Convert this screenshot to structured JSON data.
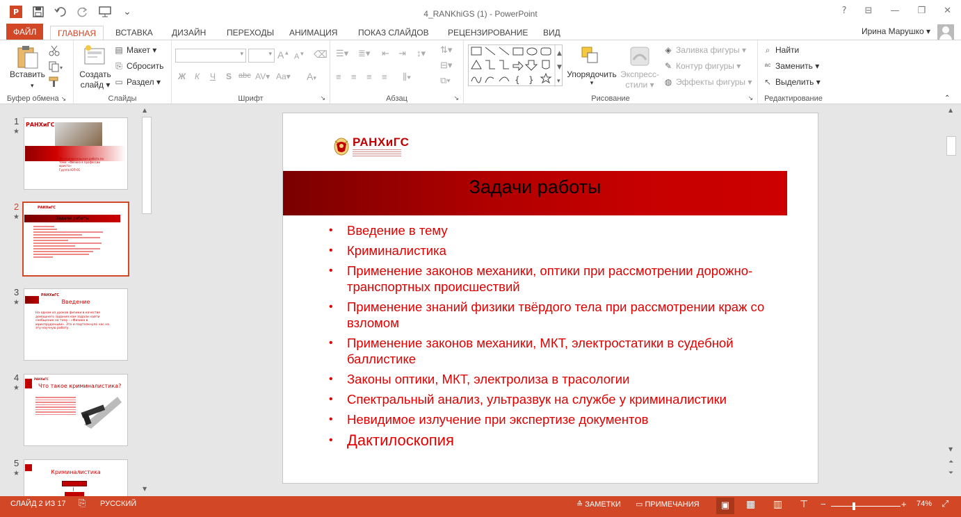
{
  "window": {
    "title": "4_RANKhiGS (1) - PowerPoint",
    "help": "?",
    "restore_ribbon": "⊟",
    "minimize": "—",
    "maximize": "❐",
    "close": "✕"
  },
  "qat": {
    "app_logo": "P",
    "save_icon": "save-icon",
    "undo_icon": "undo-icon",
    "redo_icon": "redo-icon",
    "present_icon": "present-icon",
    "customize": "⌄"
  },
  "tabs": [
    "ФАЙЛ",
    "ГЛАВНАЯ",
    "ВСТАВКА",
    "ДИЗАЙН",
    "ПЕРЕХОДЫ",
    "АНИМАЦИЯ",
    "ПОКАЗ СЛАЙДОВ",
    "РЕЦЕНЗИРОВАНИЕ",
    "ВИД"
  ],
  "user": {
    "name": "Ирина Марушко"
  },
  "ribbon": {
    "clipboard": {
      "label": "Буфер обмена",
      "paste": "Вставить"
    },
    "slides": {
      "label": "Слайды",
      "new_slide_1": "Создать",
      "new_slide_2": "слайд",
      "layout": "Макет",
      "reset": "Сбросить",
      "section": "Раздел"
    },
    "font": {
      "label": "Шрифт",
      "bold": "Ж",
      "italic": "К",
      "underline": "Ч",
      "shadow": "S",
      "strike": "abc",
      "spacing": "AV",
      "case": "Aa",
      "grow": "A",
      "shrink": "A",
      "color": "A"
    },
    "paragraph": {
      "label": "Абзац"
    },
    "drawing": {
      "label": "Рисование",
      "arrange": "Упорядочить",
      "quick_styles_1": "Экспресс-",
      "quick_styles_2": "стили",
      "fill": "Заливка фигуры",
      "outline": "Контур фигуры",
      "effects": "Эффекты фигуры"
    },
    "editing": {
      "label": "Редактирование",
      "find": "Найти",
      "replace": "Заменить",
      "select": "Выделить"
    }
  },
  "thumbnails": [
    {
      "num": "1",
      "caption": "Исследовательская работа по теме: «Физика в профессии юриста»",
      "group": "Группа ЮП-01"
    },
    {
      "num": "2",
      "title": "Задачи работы"
    },
    {
      "num": "3",
      "title": "Введение",
      "text": "На одном из уроков физики в качестве домашнего задания нам задали найти сообщение на тему - «Физика в юриспруденции». Это и подтолкнуло нас на эту научную работу."
    },
    {
      "num": "4",
      "title": "Что такое криминалистика?"
    },
    {
      "num": "5",
      "title": "Криминалистика"
    }
  ],
  "slide": {
    "logo": "РАНХиГС",
    "title": "Задачи работы",
    "bullets": [
      "Введение в тему",
      "Криминалистика",
      "Применение законов механики, оптики при рассмотрении дорожно-транспортных происшествий",
      "Применение знаний физики твёрдого тела при рассмотрении краж со взломом",
      "Применение законов механики, МКТ, электростатики в судебной баллистике",
      "Законы оптики, МКТ, электролиза в трасологии",
      "Спектральный анализ, ультразвук на службе у криминалистики",
      "Невидимое излучение при экспертизе документов",
      "Дактилоскопия"
    ]
  },
  "status": {
    "slide_count": "СЛАЙД 2 ИЗ 17",
    "language": "РУССКИЙ",
    "notes": "ЗАМЕТКИ",
    "comments": "ПРИМЕЧАНИЯ",
    "zoom_minus": "−",
    "zoom_plus": "+",
    "zoom": "74%",
    "zoom_level": 0.74
  },
  "colors": {
    "accent": "#d24726",
    "slide_red": "#e00000",
    "band_dark": "#7a0000",
    "band_light": "#cc0000"
  }
}
